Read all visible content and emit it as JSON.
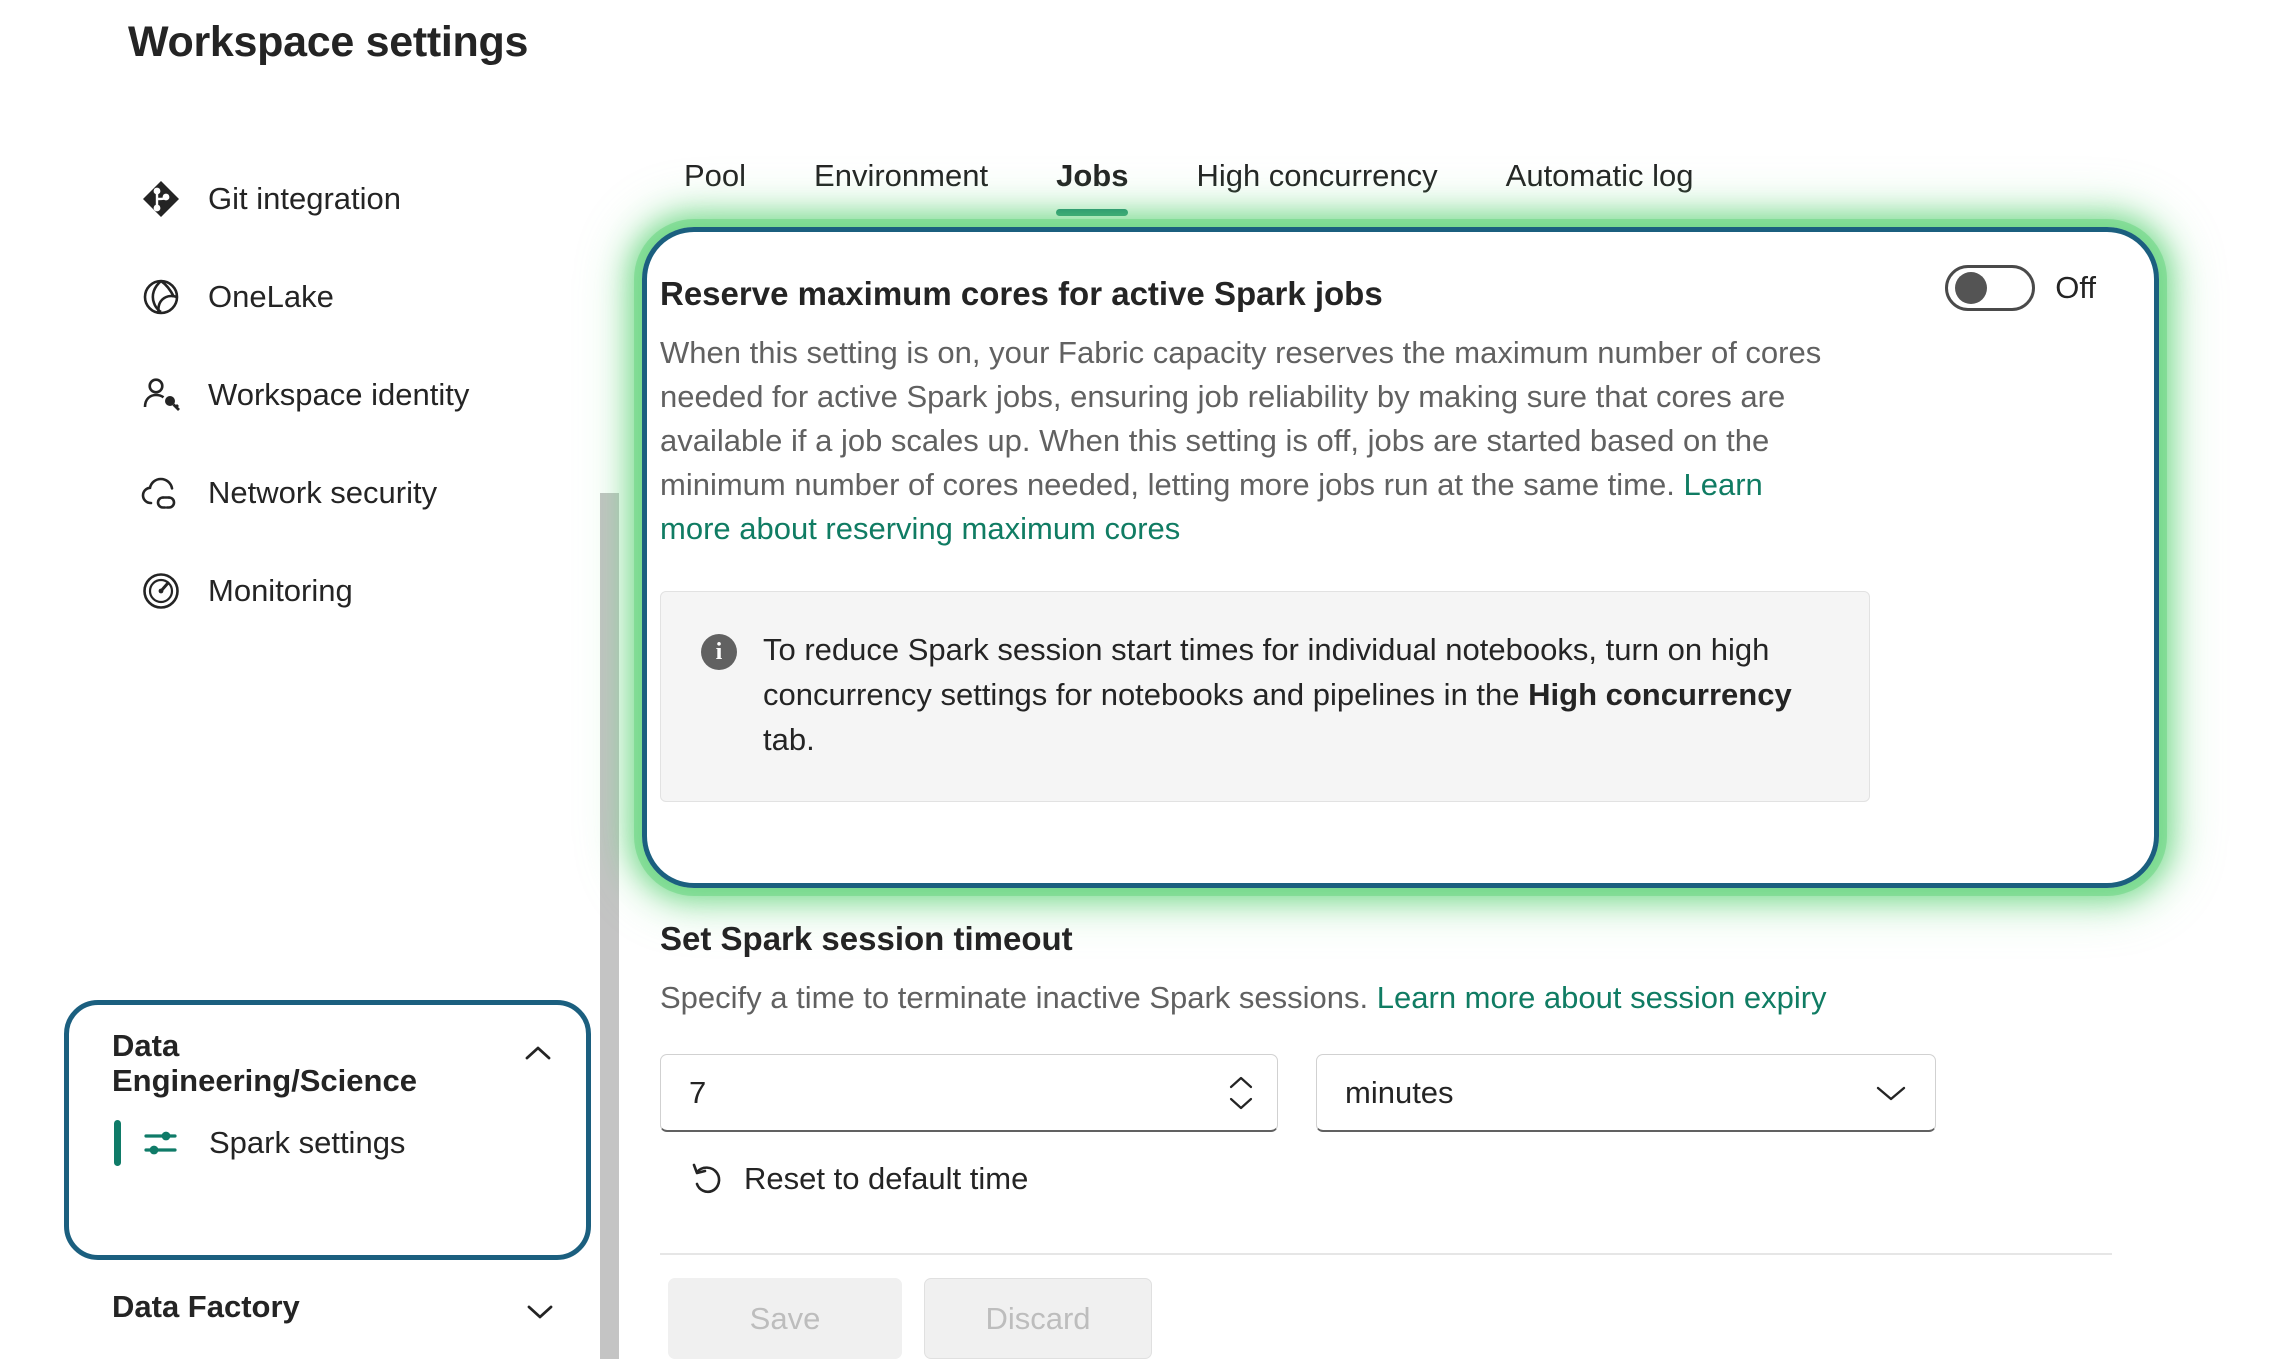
{
  "page": {
    "title": "Workspace settings"
  },
  "sidebar": {
    "items": [
      {
        "label": "Git integration",
        "icon": "git-branch-icon"
      },
      {
        "label": "OneLake",
        "icon": "onelake-icon"
      },
      {
        "label": "Workspace identity",
        "icon": "person-key-icon"
      },
      {
        "label": "Network security",
        "icon": "cloud-link-icon"
      },
      {
        "label": "Monitoring",
        "icon": "gauge-icon"
      }
    ],
    "groups": [
      {
        "title": "Data Engineering/Science",
        "expanded": true,
        "chevron": "chevron-up-icon",
        "children": [
          {
            "label": "Spark settings",
            "icon": "sliders-icon",
            "selected": true
          }
        ]
      },
      {
        "title": "Data Factory",
        "expanded": false,
        "chevron": "chevron-down-icon",
        "children": []
      }
    ]
  },
  "tabs": [
    {
      "label": "Pool",
      "active": false
    },
    {
      "label": "Environment",
      "active": false
    },
    {
      "label": "Jobs",
      "active": true
    },
    {
      "label": "High concurrency",
      "active": false
    },
    {
      "label": "Automatic log",
      "active": false
    }
  ],
  "setting": {
    "title": "Reserve maximum cores for active Spark jobs",
    "toggle_state": "Off",
    "description": "When this setting is on, your Fabric capacity reserves the maximum number of cores needed for active Spark jobs, ensuring job reliability by making sure that cores are available if a job scales up. When this setting is off, jobs are started based on the minimum number of cores needed, letting more jobs run at the same time.",
    "learn_more": "Learn more about reserving maximum cores",
    "info": {
      "icon": "info-icon",
      "text_before": "To reduce Spark session start times for individual notebooks, turn on high concurrency settings for notebooks and pipelines in the ",
      "text_bold": "High concurrency",
      "text_after": " tab."
    }
  },
  "timeout": {
    "title": "Set Spark session timeout",
    "description": "Specify a time to terminate inactive Spark sessions.",
    "learn_more": "Learn more about session expiry",
    "value": "7",
    "unit": "minutes",
    "unit_chevron": "chevron-down-icon",
    "spinner_up": "chevron-up-icon",
    "spinner_down": "chevron-down-icon",
    "reset_label": "Reset to default time",
    "reset_icon": "undo-arrow-icon"
  },
  "actions": {
    "save": "Save",
    "discard": "Discard"
  },
  "colors": {
    "accent_green": "#0f7b68",
    "link_green": "#107c63",
    "annotation_border": "#1b5f7f",
    "annotation_glow": "#6ad682",
    "text_primary": "#242424",
    "text_secondary": "#616161"
  }
}
